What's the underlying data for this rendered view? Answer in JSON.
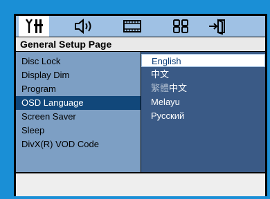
{
  "tabs": [
    {
      "icon": "general-setup-icon",
      "active": true
    },
    {
      "icon": "audio-speaker-icon",
      "active": false
    },
    {
      "icon": "video-film-icon",
      "active": false
    },
    {
      "icon": "preference-grid-icon",
      "active": false
    },
    {
      "icon": "exit-door-icon",
      "active": false
    }
  ],
  "page_title": "General Setup Page",
  "menu": {
    "items": [
      "Disc Lock",
      "Display Dim",
      "Program",
      "OSD Language",
      "Screen Saver",
      "Sleep",
      "DivX(R) VOD Code"
    ],
    "selected_index": 3
  },
  "options": {
    "items": [
      "English",
      "中文",
      "中文",
      "Melayu",
      "Русский"
    ],
    "trad_prefix": "繁體",
    "selected_index": 0
  },
  "colors": {
    "background": "#1a8fd6",
    "tab_bar": "#9fc1e4",
    "menu_panel": "#7d9fc4",
    "options_panel": "#3a5a86",
    "highlight": "#11477a"
  }
}
